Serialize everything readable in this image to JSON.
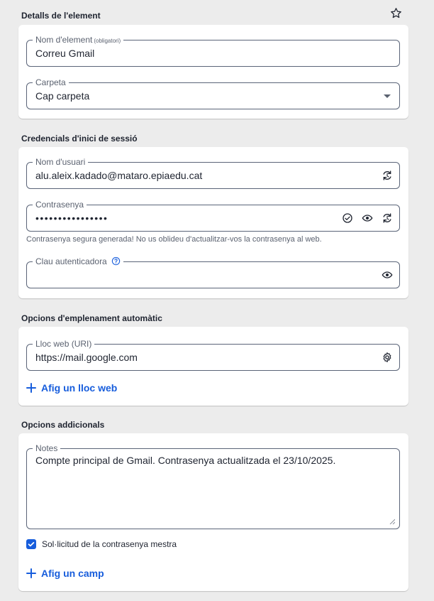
{
  "details": {
    "section_title": "Detalls de l'element",
    "name_label": "Nom d'element",
    "name_required": "(obligatori)",
    "name_value": "Correu Gmail",
    "folder_label": "Carpeta",
    "folder_value": "Cap carpeta"
  },
  "credentials": {
    "section_title": "Credencials d'inici de sessió",
    "username_label": "Nom d'usuari",
    "username_value": "alu.aleix.kadado@mataro.epiaedu.cat",
    "password_label": "Contrasenya",
    "password_value": "••••••••••••••••",
    "password_hint": "Contrasenya segura generada! No us oblideu d'actualitzar-vos la contrasenya al web.",
    "totp_label": "Clau autenticadora",
    "totp_value": ""
  },
  "autofill": {
    "section_title": "Opcions d'emplenament automàtic",
    "uri_label": "Lloc web (URI)",
    "uri_value": "https://mail.google.com",
    "add_website_label": "Afig un lloc web"
  },
  "additional": {
    "section_title": "Opcions addicionals",
    "notes_label": "Notes",
    "notes_value": "Compte principal de Gmail. Contrasenya actualitzada el 23/10/2025.",
    "master_password_label": "Sol·licitud de la contrasenya mestra",
    "master_password_checked": true,
    "add_field_label": "Afig un camp"
  },
  "colors": {
    "accent": "#175ddc",
    "background": "#ececec",
    "card": "#ffffff",
    "border": "#5a6478"
  },
  "icons": [
    "star-icon",
    "dropdown-arrow-icon",
    "generate-icon",
    "check-circle-icon",
    "eye-icon",
    "help-icon",
    "gear-icon",
    "plus-icon",
    "checkbox-check-icon"
  ]
}
